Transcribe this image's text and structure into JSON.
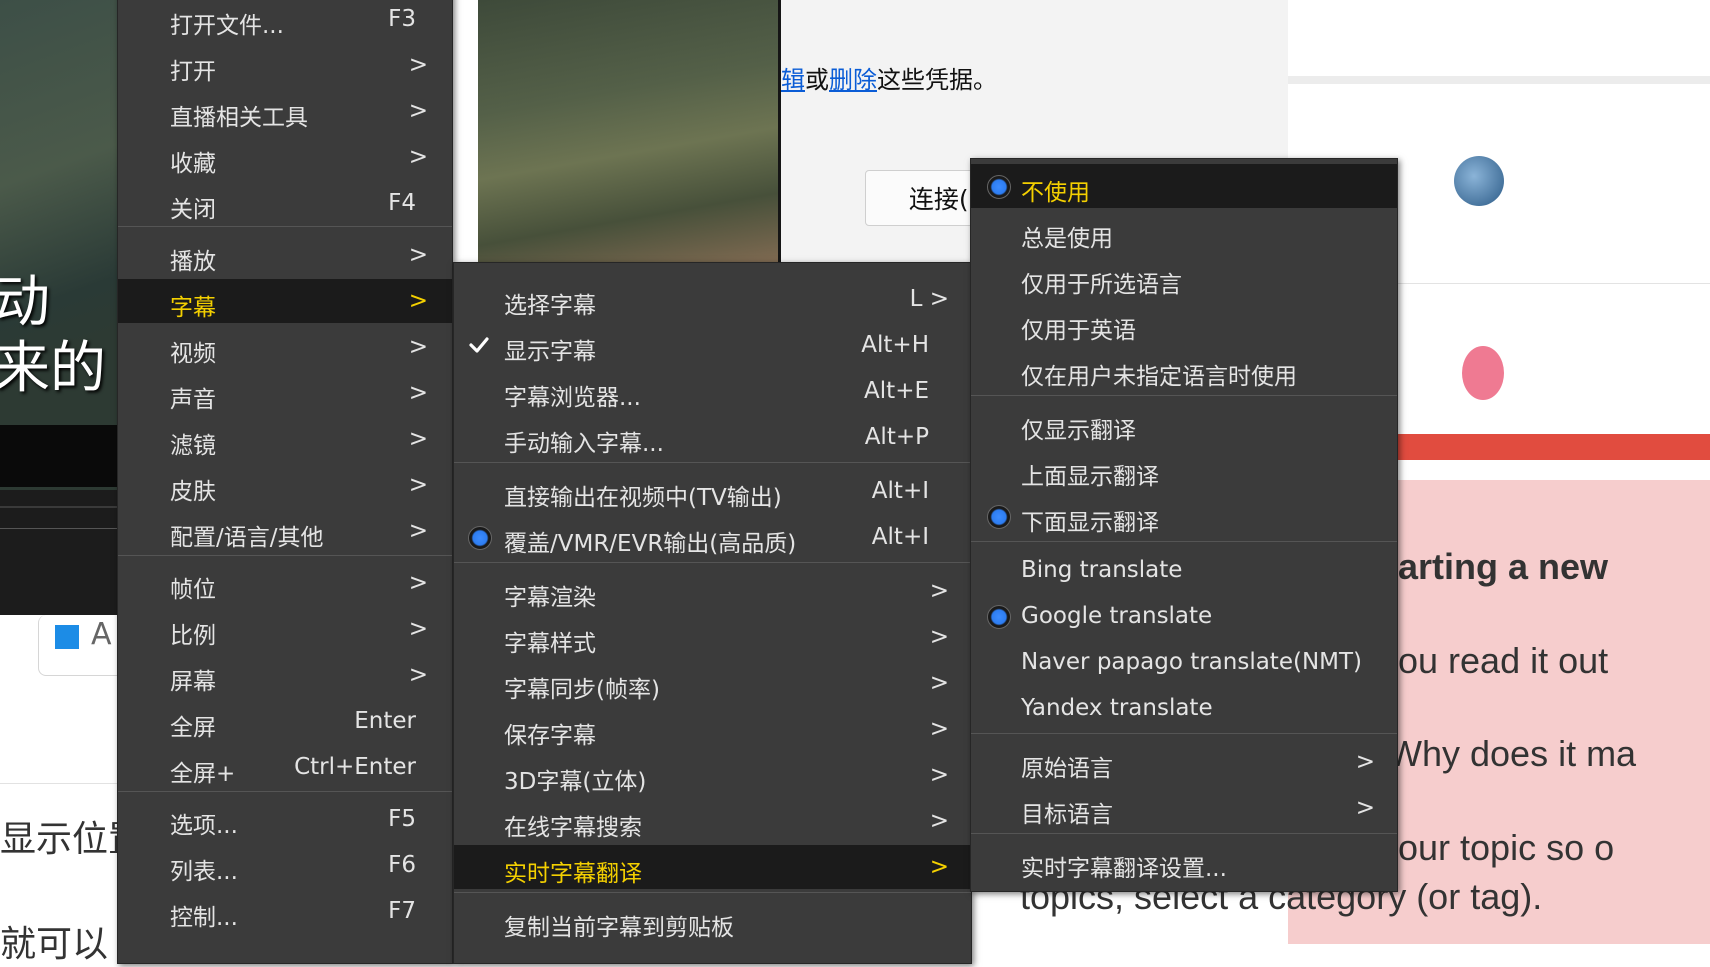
{
  "background": {
    "video_subtitle": "动\n来的",
    "dialog": {
      "text_prefix": "辑",
      "text_or": "或",
      "text_delete_link": "删除",
      "text_suffix": "这些凭据。",
      "connect_button": "连接(N)"
    },
    "webpage": {
      "line1": "arting a new",
      "line2": "ou read it out",
      "line3": "Why does it ma",
      "line4": "our topic so o",
      "line5": "topics, select a category (or tag)."
    },
    "left_page": {
      "card_text": "A",
      "line1": "显示位置",
      "line2": "就可以"
    }
  },
  "main_menu": {
    "items": [
      {
        "label": "打开文件...",
        "accel": "F3",
        "arrow": ""
      },
      {
        "label": "打开",
        "accel": "",
        "arrow": ">"
      },
      {
        "label": "直播相关工具",
        "accel": "",
        "arrow": ">"
      },
      {
        "label": "收藏",
        "accel": "",
        "arrow": ">"
      },
      {
        "label": "关闭",
        "accel": "F4",
        "arrow": ""
      },
      {
        "label": "播放",
        "accel": "",
        "arrow": ">"
      },
      {
        "label": "字幕",
        "accel": "",
        "arrow": ">",
        "highlighted": true
      },
      {
        "label": "视频",
        "accel": "",
        "arrow": ">"
      },
      {
        "label": "声音",
        "accel": "",
        "arrow": ">"
      },
      {
        "label": "滤镜",
        "accel": "",
        "arrow": ">"
      },
      {
        "label": "皮肤",
        "accel": "",
        "arrow": ">"
      },
      {
        "label": "配置/语言/其他",
        "accel": "",
        "arrow": ">"
      },
      {
        "label": "帧位",
        "accel": "",
        "arrow": ">"
      },
      {
        "label": "比例",
        "accel": "",
        "arrow": ">"
      },
      {
        "label": "屏幕",
        "accel": "",
        "arrow": ">"
      },
      {
        "label": "全屏",
        "accel": "Enter",
        "arrow": ""
      },
      {
        "label": "全屏+",
        "accel": "Ctrl+Enter",
        "arrow": ""
      },
      {
        "label": "选项...",
        "accel": "F5",
        "arrow": ""
      },
      {
        "label": "列表...",
        "accel": "F6",
        "arrow": ""
      },
      {
        "label": "控制...",
        "accel": "F7",
        "arrow": ""
      }
    ]
  },
  "subtitle_menu": {
    "items": [
      {
        "label": "选择字幕",
        "accel": "L >",
        "mark": ""
      },
      {
        "label": "显示字幕",
        "accel": "Alt+H",
        "mark": "check"
      },
      {
        "label": "字幕浏览器...",
        "accel": "Alt+E",
        "mark": ""
      },
      {
        "label": "手动输入字幕...",
        "accel": "Alt+P",
        "mark": ""
      },
      {
        "label": "直接输出在视频中(TV输出)",
        "accel": "Alt+I",
        "mark": ""
      },
      {
        "label": "覆盖/VMR/EVR输出(高品质)",
        "accel": "Alt+I",
        "mark": "radio"
      },
      {
        "label": "字幕渲染",
        "arrow": ">"
      },
      {
        "label": "字幕样式",
        "arrow": ">"
      },
      {
        "label": "字幕同步(帧率)",
        "arrow": ">"
      },
      {
        "label": "保存字幕",
        "arrow": ">"
      },
      {
        "label": "3D字幕(立体)",
        "arrow": ">"
      },
      {
        "label": "在线字幕搜索",
        "arrow": ">"
      },
      {
        "label": "实时字幕翻译",
        "arrow": ">",
        "highlighted": true
      },
      {
        "label": "复制当前字幕到剪贴板",
        "arrow": ""
      }
    ]
  },
  "translate_menu": {
    "items": [
      {
        "label": "不使用",
        "mark": "radio",
        "highlighted": true
      },
      {
        "label": "总是使用",
        "mark": ""
      },
      {
        "label": "仅用于所选语言",
        "mark": ""
      },
      {
        "label": "仅用于英语",
        "mark": ""
      },
      {
        "label": "仅在用户未指定语言时使用",
        "mark": ""
      },
      {
        "label": "仅显示翻译",
        "mark": ""
      },
      {
        "label": "上面显示翻译",
        "mark": ""
      },
      {
        "label": "下面显示翻译",
        "mark": "radio"
      },
      {
        "label": "Bing translate",
        "mark": ""
      },
      {
        "label": "Google translate",
        "mark": "radio"
      },
      {
        "label": "Naver papago translate(NMT)",
        "mark": ""
      },
      {
        "label": "Yandex translate",
        "mark": ""
      },
      {
        "label": "原始语言",
        "arrow": ">"
      },
      {
        "label": "目标语言",
        "arrow": ">"
      },
      {
        "label": "实时字幕翻译设置...",
        "arrow": ""
      }
    ]
  }
}
